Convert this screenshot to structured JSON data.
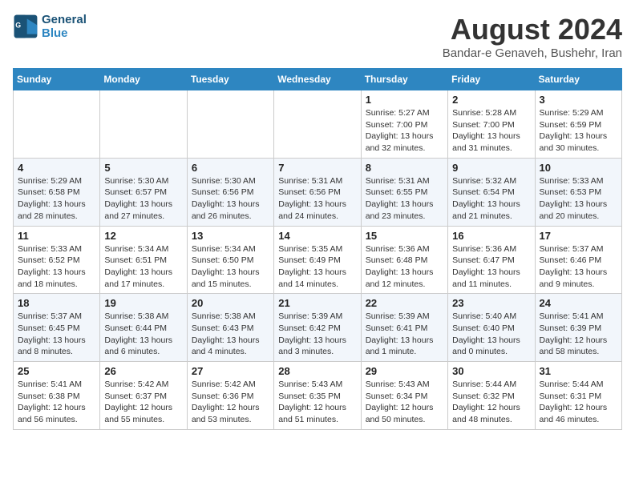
{
  "header": {
    "logo_line1": "General",
    "logo_line2": "Blue",
    "month_title": "August 2024",
    "subtitle": "Bandar-e Genaveh, Bushehr, Iran"
  },
  "weekdays": [
    "Sunday",
    "Monday",
    "Tuesday",
    "Wednesday",
    "Thursday",
    "Friday",
    "Saturday"
  ],
  "weeks": [
    [
      {
        "day": "",
        "info": ""
      },
      {
        "day": "",
        "info": ""
      },
      {
        "day": "",
        "info": ""
      },
      {
        "day": "",
        "info": ""
      },
      {
        "day": "1",
        "info": "Sunrise: 5:27 AM\nSunset: 7:00 PM\nDaylight: 13 hours\nand 32 minutes."
      },
      {
        "day": "2",
        "info": "Sunrise: 5:28 AM\nSunset: 7:00 PM\nDaylight: 13 hours\nand 31 minutes."
      },
      {
        "day": "3",
        "info": "Sunrise: 5:29 AM\nSunset: 6:59 PM\nDaylight: 13 hours\nand 30 minutes."
      }
    ],
    [
      {
        "day": "4",
        "info": "Sunrise: 5:29 AM\nSunset: 6:58 PM\nDaylight: 13 hours\nand 28 minutes."
      },
      {
        "day": "5",
        "info": "Sunrise: 5:30 AM\nSunset: 6:57 PM\nDaylight: 13 hours\nand 27 minutes."
      },
      {
        "day": "6",
        "info": "Sunrise: 5:30 AM\nSunset: 6:56 PM\nDaylight: 13 hours\nand 26 minutes."
      },
      {
        "day": "7",
        "info": "Sunrise: 5:31 AM\nSunset: 6:56 PM\nDaylight: 13 hours\nand 24 minutes."
      },
      {
        "day": "8",
        "info": "Sunrise: 5:31 AM\nSunset: 6:55 PM\nDaylight: 13 hours\nand 23 minutes."
      },
      {
        "day": "9",
        "info": "Sunrise: 5:32 AM\nSunset: 6:54 PM\nDaylight: 13 hours\nand 21 minutes."
      },
      {
        "day": "10",
        "info": "Sunrise: 5:33 AM\nSunset: 6:53 PM\nDaylight: 13 hours\nand 20 minutes."
      }
    ],
    [
      {
        "day": "11",
        "info": "Sunrise: 5:33 AM\nSunset: 6:52 PM\nDaylight: 13 hours\nand 18 minutes."
      },
      {
        "day": "12",
        "info": "Sunrise: 5:34 AM\nSunset: 6:51 PM\nDaylight: 13 hours\nand 17 minutes."
      },
      {
        "day": "13",
        "info": "Sunrise: 5:34 AM\nSunset: 6:50 PM\nDaylight: 13 hours\nand 15 minutes."
      },
      {
        "day": "14",
        "info": "Sunrise: 5:35 AM\nSunset: 6:49 PM\nDaylight: 13 hours\nand 14 minutes."
      },
      {
        "day": "15",
        "info": "Sunrise: 5:36 AM\nSunset: 6:48 PM\nDaylight: 13 hours\nand 12 minutes."
      },
      {
        "day": "16",
        "info": "Sunrise: 5:36 AM\nSunset: 6:47 PM\nDaylight: 13 hours\nand 11 minutes."
      },
      {
        "day": "17",
        "info": "Sunrise: 5:37 AM\nSunset: 6:46 PM\nDaylight: 13 hours\nand 9 minutes."
      }
    ],
    [
      {
        "day": "18",
        "info": "Sunrise: 5:37 AM\nSunset: 6:45 PM\nDaylight: 13 hours\nand 8 minutes."
      },
      {
        "day": "19",
        "info": "Sunrise: 5:38 AM\nSunset: 6:44 PM\nDaylight: 13 hours\nand 6 minutes."
      },
      {
        "day": "20",
        "info": "Sunrise: 5:38 AM\nSunset: 6:43 PM\nDaylight: 13 hours\nand 4 minutes."
      },
      {
        "day": "21",
        "info": "Sunrise: 5:39 AM\nSunset: 6:42 PM\nDaylight: 13 hours\nand 3 minutes."
      },
      {
        "day": "22",
        "info": "Sunrise: 5:39 AM\nSunset: 6:41 PM\nDaylight: 13 hours\nand 1 minute."
      },
      {
        "day": "23",
        "info": "Sunrise: 5:40 AM\nSunset: 6:40 PM\nDaylight: 13 hours\nand 0 minutes."
      },
      {
        "day": "24",
        "info": "Sunrise: 5:41 AM\nSunset: 6:39 PM\nDaylight: 12 hours\nand 58 minutes."
      }
    ],
    [
      {
        "day": "25",
        "info": "Sunrise: 5:41 AM\nSunset: 6:38 PM\nDaylight: 12 hours\nand 56 minutes."
      },
      {
        "day": "26",
        "info": "Sunrise: 5:42 AM\nSunset: 6:37 PM\nDaylight: 12 hours\nand 55 minutes."
      },
      {
        "day": "27",
        "info": "Sunrise: 5:42 AM\nSunset: 6:36 PM\nDaylight: 12 hours\nand 53 minutes."
      },
      {
        "day": "28",
        "info": "Sunrise: 5:43 AM\nSunset: 6:35 PM\nDaylight: 12 hours\nand 51 minutes."
      },
      {
        "day": "29",
        "info": "Sunrise: 5:43 AM\nSunset: 6:34 PM\nDaylight: 12 hours\nand 50 minutes."
      },
      {
        "day": "30",
        "info": "Sunrise: 5:44 AM\nSunset: 6:32 PM\nDaylight: 12 hours\nand 48 minutes."
      },
      {
        "day": "31",
        "info": "Sunrise: 5:44 AM\nSunset: 6:31 PM\nDaylight: 12 hours\nand 46 minutes."
      }
    ]
  ]
}
